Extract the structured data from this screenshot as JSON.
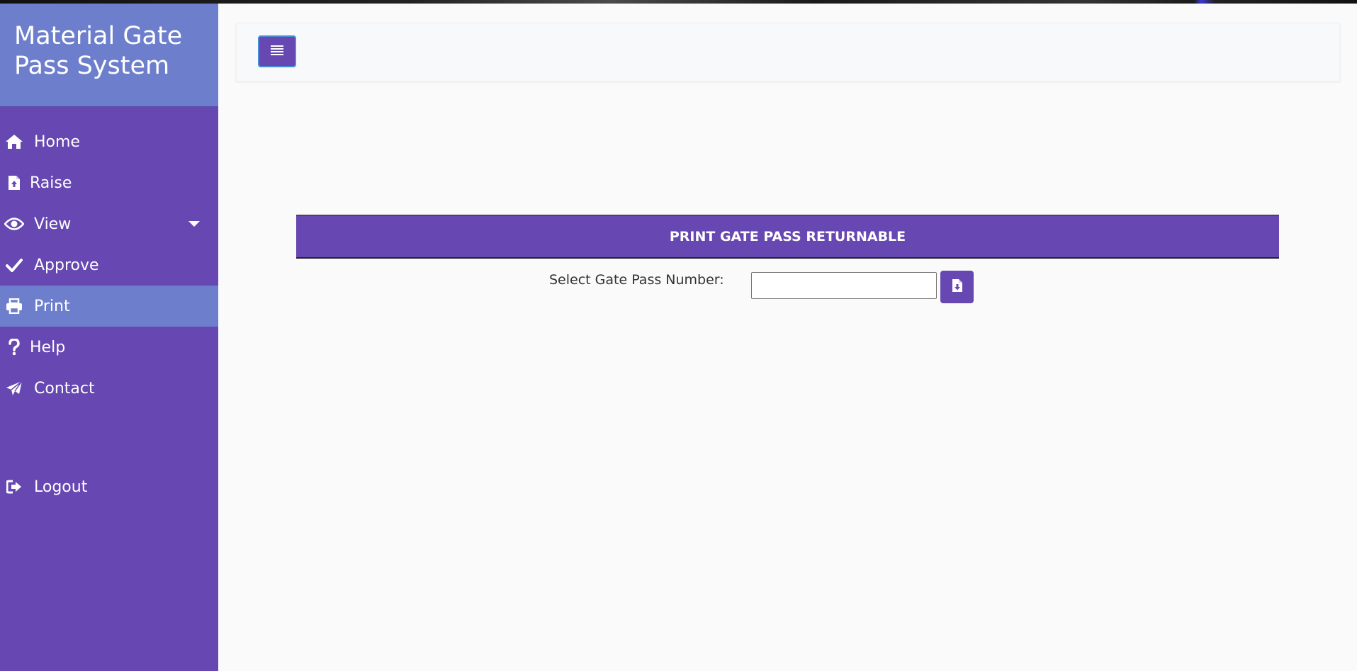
{
  "app": {
    "title": "Material Gate Pass System"
  },
  "sidebar": {
    "items": [
      {
        "label": "Home",
        "icon": "home-icon"
      },
      {
        "label": "Raise",
        "icon": "file-upload-icon"
      },
      {
        "label": "View",
        "icon": "eye-icon"
      },
      {
        "label": "Approve",
        "icon": "check-icon"
      },
      {
        "label": "Print",
        "icon": "print-icon",
        "active": true
      },
      {
        "label": "Help",
        "icon": "question-icon"
      },
      {
        "label": "Contact",
        "icon": "paper-plane-icon"
      }
    ],
    "logout": {
      "label": "Logout",
      "icon": "sign-out-icon"
    }
  },
  "header": {
    "toggle_icon": "menu-lines-icon"
  },
  "main": {
    "panel_title": "PRINT GATE PASS RETURNABLE",
    "field_label": "Select Gate Pass Number:",
    "field_value": "",
    "download_icon": "file-download-icon"
  },
  "colors": {
    "sidebar": "#6747b1",
    "active": "#6d7fcc",
    "background": "#fafafa"
  }
}
